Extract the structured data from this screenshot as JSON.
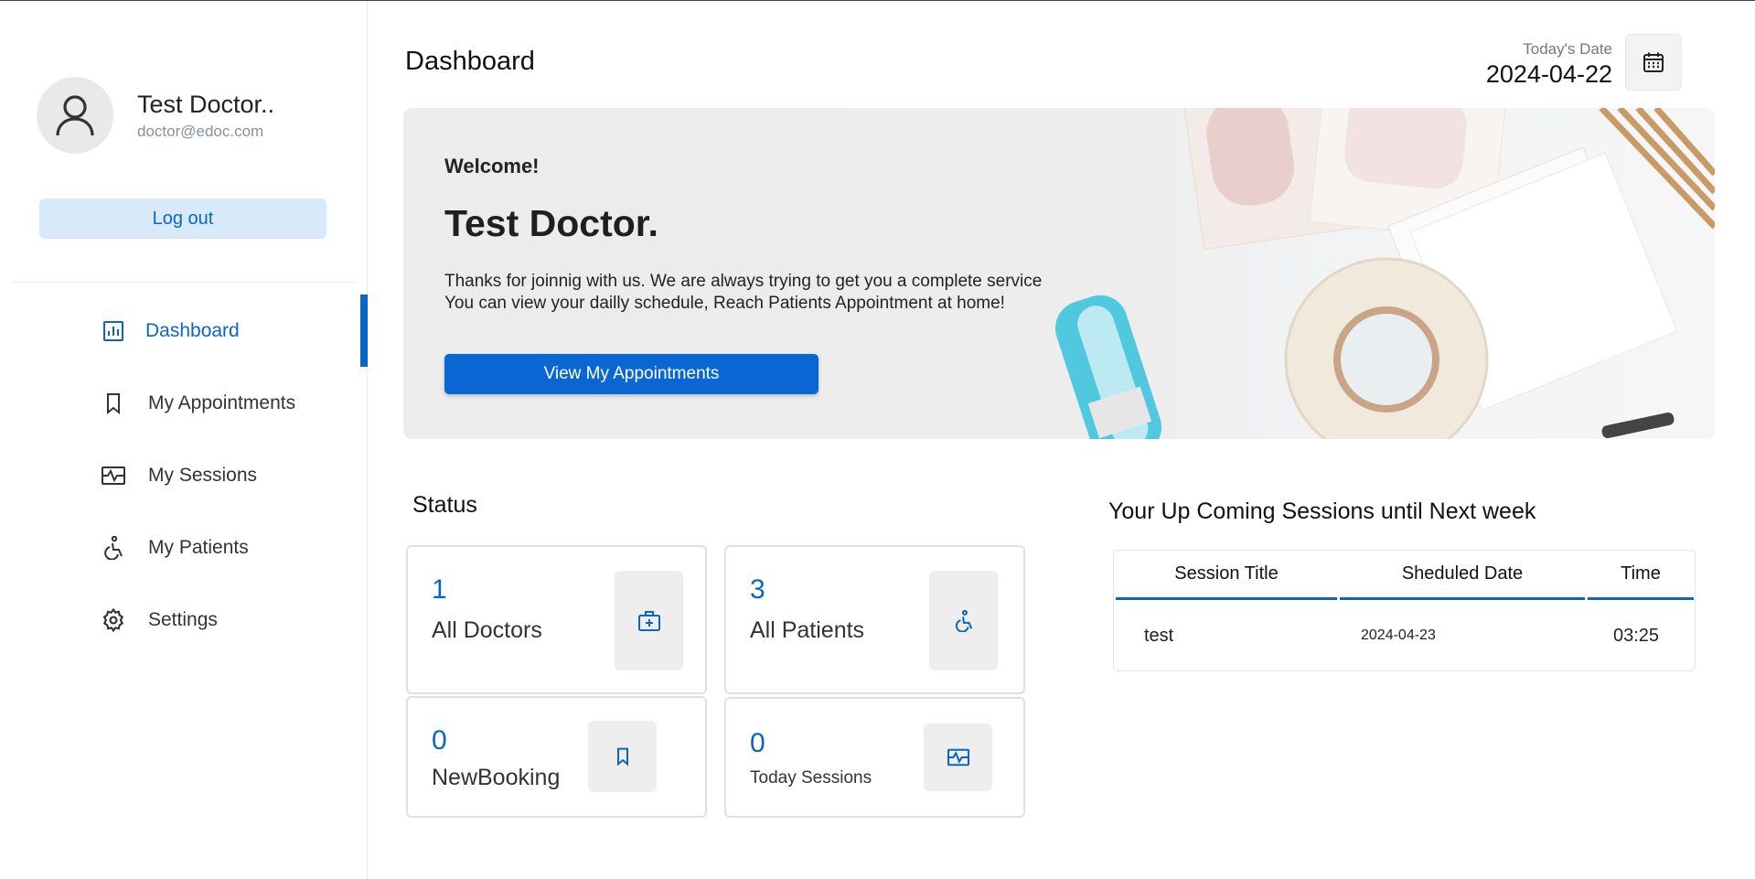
{
  "profile": {
    "name": "Test Doctor..",
    "email": "doctor@edoc.com"
  },
  "sidebar": {
    "logout_label": "Log out",
    "items": [
      {
        "label": "Dashboard",
        "icon": "dashboard-icon",
        "active": true
      },
      {
        "label": "My Appointments",
        "icon": "bookmark-icon",
        "active": false
      },
      {
        "label": "My Sessions",
        "icon": "sessions-icon",
        "active": false
      },
      {
        "label": "My Patients",
        "icon": "wheelchair-icon",
        "active": false
      },
      {
        "label": "Settings",
        "icon": "gear-icon",
        "active": false
      }
    ]
  },
  "header": {
    "title": "Dashboard",
    "date_label": "Today's Date",
    "date_value": "2024-04-22"
  },
  "banner": {
    "welcome": "Welcome!",
    "name": "Test Doctor.",
    "line1": "Thanks for joinnig with us. We are always trying to get you a complete service",
    "line2": "You can view your dailly schedule, Reach Patients Appointment at home!",
    "button_label": "View My Appointments"
  },
  "status": {
    "title": "Status",
    "cards": [
      {
        "value": "1",
        "label": "All Doctors",
        "icon": "medical-kit-icon"
      },
      {
        "value": "3",
        "label": "All Patients",
        "icon": "wheelchair-icon"
      },
      {
        "value": "0",
        "label": "NewBooking",
        "icon": "bookmark-icon"
      },
      {
        "value": "0",
        "label": "Today Sessions",
        "icon": "sessions-icon"
      }
    ]
  },
  "sessions": {
    "title": "Your Up Coming Sessions until Next week",
    "columns": [
      "Session Title",
      "Sheduled Date",
      "Time"
    ],
    "rows": [
      {
        "title": "test",
        "date": "2024-04-23",
        "time": "03:25"
      }
    ]
  },
  "colors": {
    "accent": "#0a66c2",
    "logout_bg": "#d8e9fa",
    "card_icon_bg": "#eeeeee"
  }
}
